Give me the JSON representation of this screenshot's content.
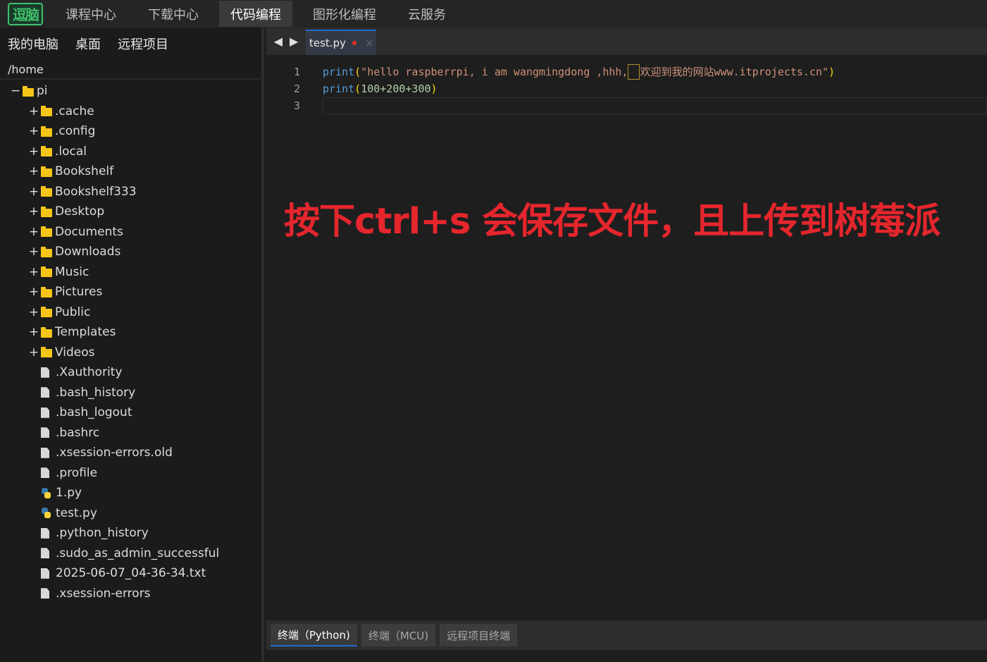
{
  "nav": {
    "logo": "逗脑",
    "tabs": [
      "课程中心",
      "下载中心",
      "代码编程",
      "图形化编程",
      "云服务"
    ],
    "active_tab": "代码编程"
  },
  "sidebar": {
    "location_tabs": [
      "我的电脑",
      "桌面",
      "远程项目"
    ],
    "path": "/home",
    "root": {
      "toggle": "−",
      "name": "pi"
    },
    "folders": [
      ".cache",
      ".config",
      ".local",
      "Bookshelf",
      "Bookshelf333",
      "Desktop",
      "Documents",
      "Downloads",
      "Music",
      "Pictures",
      "Public",
      "Templates",
      "Videos"
    ],
    "folder_toggle": "+",
    "files": [
      {
        "name": ".Xauthority",
        "icon": "file-icon"
      },
      {
        "name": ".bash_history",
        "icon": "file-icon"
      },
      {
        "name": ".bash_logout",
        "icon": "file-icon"
      },
      {
        "name": ".bashrc",
        "icon": "file-icon"
      },
      {
        "name": ".xsession-errors.old",
        "icon": "file-icon"
      },
      {
        "name": ".profile",
        "icon": "file-icon"
      },
      {
        "name": "1.py",
        "icon": "python-icon"
      },
      {
        "name": "test.py",
        "icon": "python-icon"
      },
      {
        "name": ".python_history",
        "icon": "file-icon"
      },
      {
        "name": ".sudo_as_admin_successful",
        "icon": "file-icon"
      },
      {
        "name": "2025-06-07_04-36-34.txt",
        "icon": "file-icon"
      },
      {
        "name": ".xsession-errors",
        "icon": "file-icon"
      }
    ]
  },
  "editor": {
    "tab_label": "test.py",
    "tab_close": "×",
    "nav_left": "◀",
    "nav_right": "▶",
    "line_numbers": [
      "1",
      "2",
      "3"
    ],
    "line1": {
      "kw": "print",
      "open": "(",
      "str_a": "\"hello raspberrpi, i am wangmingdong ,hhh,",
      "str_b": "欢迎到我的网站www.itprojects.cn\"",
      "close": ")"
    },
    "line2": {
      "kw": "print",
      "open": "(",
      "expr": "100+200+300",
      "close": ")"
    }
  },
  "overlay_text": "按下ctrl+s 会保存文件，且上传到树莓派",
  "terminal_tabs": [
    "终端（Python)",
    "终端（MCU)",
    "远程项目终端"
  ]
}
